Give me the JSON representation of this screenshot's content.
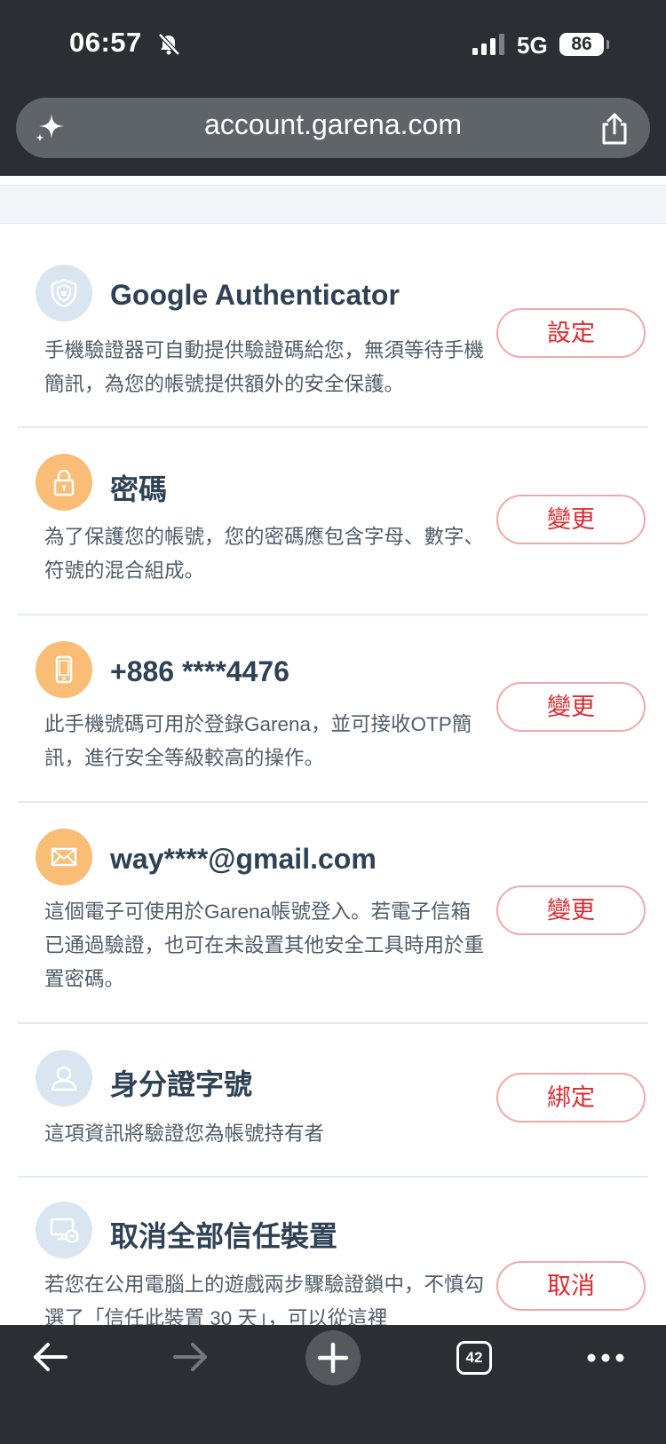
{
  "status_bar": {
    "time": "06:57",
    "network": "5G",
    "battery": "86"
  },
  "browser": {
    "url": "account.garena.com",
    "tab_count": "42"
  },
  "items": [
    {
      "title": "Google Authenticator",
      "description": "手機驗證器可自動提供驗證碼給您，無須等待手機簡訊，為您的帳號提供額外的安全保護。",
      "button": "設定",
      "icon": "shield-icon"
    },
    {
      "title": "密碼",
      "description": "為了保護您的帳號，您的密碼應包含字母、數字、符號的混合組成。",
      "button": "變更",
      "icon": "lock-icon"
    },
    {
      "title": "+886 ****4476",
      "description": "此手機號碼可用於登錄Garena，並可接收OTP簡訊，進行安全等級較高的操作。",
      "button": "變更",
      "icon": "phone-icon"
    },
    {
      "title": "way****@gmail.com",
      "description": "這個電子可使用於Garena帳號登入。若電子信箱已通過驗證，也可在未設置其他安全工具時用於重置密碼。",
      "button": "變更",
      "icon": "mail-icon"
    },
    {
      "title": "身分證字號",
      "description": "這項資訊將驗證您為帳號持有者",
      "button": "綁定",
      "icon": "id-card-icon"
    },
    {
      "title": "取消全部信任裝置",
      "description": "若您在公用電腦上的遊戲兩步驟驗證鎖中，不慎勾選了「信任此裝置 30 天」，可以從這裡",
      "button": "取消",
      "icon": "device-icon"
    }
  ]
}
